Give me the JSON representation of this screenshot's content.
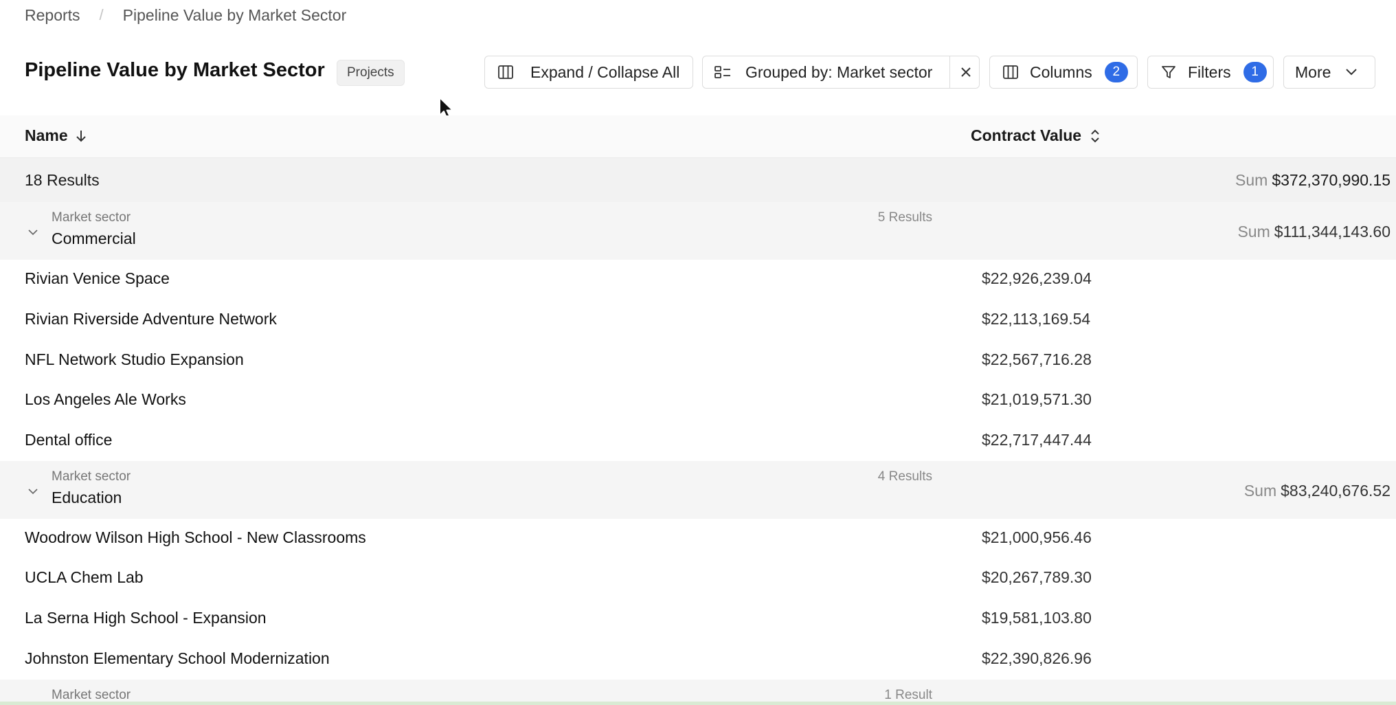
{
  "breadcrumb": {
    "root": "Reports",
    "current": "Pipeline Value by Market Sector"
  },
  "header": {
    "title": "Pipeline Value by Market Sector",
    "tag": "Projects"
  },
  "toolbar": {
    "expand_label": "Expand / Collapse All",
    "grouped_label": "Grouped by: Market sector",
    "columns_label": "Columns",
    "columns_count": "2",
    "filters_label": "Filters",
    "filters_count": "1",
    "more_label": "More"
  },
  "table": {
    "columns": [
      "Name",
      "Contract Value"
    ],
    "summary": {
      "count": "18 Results",
      "sum_label": "Sum",
      "sum_value": "$372,370,990.15"
    },
    "groups": [
      {
        "label": "Market sector",
        "name": "Commercial",
        "count": "5 Results",
        "sum_label": "Sum",
        "sum_value": "$111,344,143.60",
        "rows": [
          {
            "name": "Rivian Venice Space",
            "value": "$22,926,239.04"
          },
          {
            "name": "Rivian Riverside Adventure Network",
            "value": "$22,113,169.54"
          },
          {
            "name": "NFL Network Studio Expansion",
            "value": "$22,567,716.28"
          },
          {
            "name": "Los Angeles Ale Works",
            "value": "$21,019,571.30"
          },
          {
            "name": "Dental office",
            "value": "$22,717,447.44"
          }
        ]
      },
      {
        "label": "Market sector",
        "name": "Education",
        "count": "4 Results",
        "sum_label": "Sum",
        "sum_value": "$83,240,676.52",
        "rows": [
          {
            "name": "Woodrow Wilson High School - New Classrooms",
            "value": "$21,000,956.46"
          },
          {
            "name": "UCLA Chem Lab",
            "value": "$20,267,789.30"
          },
          {
            "name": "La Serna High School - Expansion",
            "value": "$19,581,103.80"
          },
          {
            "name": "Johnston Elementary School Modernization",
            "value": "$22,390,826.96"
          }
        ]
      },
      {
        "label": "Market sector",
        "count": "1 Result"
      }
    ]
  },
  "icons": {
    "expand": "columns-icon",
    "grouped": "group-icon",
    "close": "close-icon",
    "columns": "columns-icon",
    "filters": "filter-icon",
    "more": "chevron-down-icon",
    "sort_desc": "arrow-down-icon",
    "sort_toggle": "sort-icon",
    "collapse": "chevron-down-icon",
    "cursor": "pointer-cursor-icon"
  },
  "colors": {
    "badge": "#2f6ce6",
    "group_bg": "#f5f5f5",
    "summary_bg": "#f2f2f2"
  }
}
